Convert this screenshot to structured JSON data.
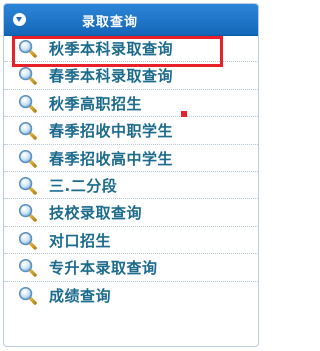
{
  "panel": {
    "title": "录取查询",
    "header_icon": "chevron-down-circle-icon",
    "colors": {
      "header_bg": "#1a6fc2",
      "item_text": "#1c6b8c",
      "highlight_border": "#e8202a"
    }
  },
  "menu": {
    "items": [
      {
        "label": "秋季本科录取查询",
        "icon": "search-icon",
        "highlighted": true
      },
      {
        "label": "春季本科录取查询",
        "icon": "search-icon"
      },
      {
        "label": "秋季高职招生",
        "icon": "search-icon"
      },
      {
        "label": "春季招收中职学生",
        "icon": "search-icon"
      },
      {
        "label": "春季招收高中学生",
        "icon": "search-icon"
      },
      {
        "label": "三.二分段",
        "icon": "search-icon"
      },
      {
        "label": "技校录取查询",
        "icon": "search-icon"
      },
      {
        "label": "对口招生",
        "icon": "search-icon"
      },
      {
        "label": "专升本录取查询",
        "icon": "search-icon"
      },
      {
        "label": "成绩查询",
        "icon": "search-icon"
      }
    ]
  }
}
